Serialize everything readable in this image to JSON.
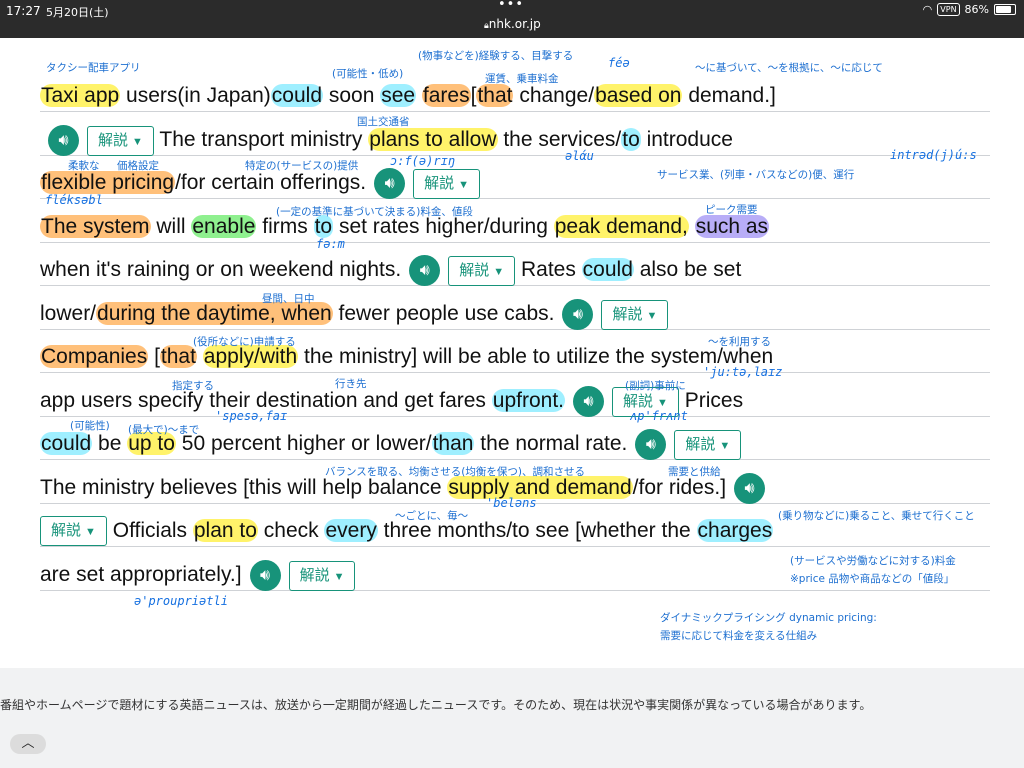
{
  "status_bar": {
    "time": "17:27",
    "date": "5月20日(土)",
    "url": "nhk.or.jp",
    "vpn": "VPN",
    "battery": "86%"
  },
  "article": {
    "lines": [
      {
        "segments": [
          {
            "t": "Taxi app",
            "hl": "y"
          },
          {
            "t": " users(in Japan)"
          },
          {
            "t": "could",
            "hl": "c"
          },
          {
            "t": " soon "
          },
          {
            "t": "see",
            "hl": "c"
          },
          {
            "t": " "
          },
          {
            "t": "fares",
            "hl": "o"
          },
          {
            "t": "["
          },
          {
            "t": "that",
            "hl": "o"
          },
          {
            "t": " change/"
          },
          {
            "t": "based on",
            "hl": "y"
          },
          {
            "t": " demand.]"
          }
        ]
      },
      {
        "segments": [
          {
            "speaker": true
          },
          {
            "expl": "解説"
          },
          {
            "t": "   The transport ministry "
          },
          {
            "t": "plans to allow",
            "hl": "y"
          },
          {
            "t": " the services/"
          },
          {
            "t": "to",
            "hl": "c"
          },
          {
            "t": " introduce"
          }
        ]
      },
      {
        "segments": [
          {
            "t": "flexible pricing",
            "hl": "o"
          },
          {
            "t": "/for certain offerings."
          },
          {
            "speaker": true
          },
          {
            "expl": "解説"
          }
        ]
      },
      {
        "segments": [
          {
            "t": "The system",
            "hl": "o"
          },
          {
            "t": " will "
          },
          {
            "t": "enable",
            "hl": "g"
          },
          {
            "t": " firms "
          },
          {
            "t": "to",
            "hl": "c"
          },
          {
            "t": " set rates higher/during "
          },
          {
            "t": "peak demand,",
            "hl": "y"
          },
          {
            "t": " "
          },
          {
            "t": "such as",
            "hl": "p"
          }
        ]
      },
      {
        "segments": [
          {
            "t": "when it's raining or on weekend nights."
          },
          {
            "speaker": true
          },
          {
            "expl": "解説"
          },
          {
            "t": "  Rates "
          },
          {
            "t": "could",
            "hl": "c"
          },
          {
            "t": " also be set"
          }
        ]
      },
      {
        "segments": [
          {
            "t": "lower/"
          },
          {
            "t": "during the daytime, when",
            "hl": "o"
          },
          {
            "t": " fewer people use cabs."
          },
          {
            "speaker": true
          },
          {
            "expl": "解説"
          }
        ]
      },
      {
        "segments": [
          {
            "t": "Companies",
            "hl": "o"
          },
          {
            "t": " ["
          },
          {
            "t": "that",
            "hl": "o"
          },
          {
            "t": " "
          },
          {
            "t": "apply/with",
            "hl": "y"
          },
          {
            "t": " the ministry] will be able to utilize the system/when"
          }
        ]
      },
      {
        "segments": [
          {
            "t": "app users specify their destination and get fares "
          },
          {
            "t": "upfront.",
            "hl": "c"
          },
          {
            "speaker": true
          },
          {
            "expl": "解説"
          },
          {
            "t": "   Prices"
          }
        ]
      },
      {
        "segments": [
          {
            "t": "could",
            "hl": "c"
          },
          {
            "t": " be "
          },
          {
            "t": "up to",
            "hl": "y"
          },
          {
            "t": " 50 percent higher or lower/"
          },
          {
            "t": "than",
            "hl": "c"
          },
          {
            "t": " the normal rate."
          },
          {
            "speaker": true
          },
          {
            "expl": "解説"
          }
        ]
      },
      {
        "segments": [
          {
            "t": "The ministry believes [this will help balance "
          },
          {
            "t": "supply and demand",
            "hl": "y"
          },
          {
            "t": "/for rides.]"
          },
          {
            "speaker": true
          }
        ]
      },
      {
        "segments": [
          {
            "expl": "解説"
          },
          {
            "t": "   Officials "
          },
          {
            "t": "plan to",
            "hl": "y"
          },
          {
            "t": " check "
          },
          {
            "t": "every",
            "hl": "c"
          },
          {
            "t": " three months/to see [whether the "
          },
          {
            "t": "charges",
            "hl": "c"
          }
        ]
      },
      {
        "segments": [
          {
            "t": "are set appropriately.]"
          },
          {
            "speaker": true
          },
          {
            "expl": "解説"
          }
        ]
      }
    ]
  },
  "annotations": [
    {
      "text": "タクシー配車アプリ"
    },
    {
      "text": "(物事などを)経験する、目撃する"
    },
    {
      "text": "(可能性・低め)"
    },
    {
      "text": "運賃、乗車料金"
    },
    {
      "text": "～に基づいて、～を根拠に、～に応じて"
    },
    {
      "text": "国土交通省"
    },
    {
      "text": "柔軟な"
    },
    {
      "text": "価格設定"
    },
    {
      "text": "特定の(サービスの)提供"
    },
    {
      "text": "サービス業、(列車・バスなどの)便、運行"
    },
    {
      "text": "(一定の基準に基づいて決まる)料金、値段"
    },
    {
      "text": "ピーク需要"
    },
    {
      "text": "昼間、日中"
    },
    {
      "text": "(役所などに)申請する"
    },
    {
      "text": "～を利用する"
    },
    {
      "text": "指定する"
    },
    {
      "text": "行き先"
    },
    {
      "text": "(副詞)事前に"
    },
    {
      "text": "(可能性)"
    },
    {
      "text": "(最大で)～まで"
    },
    {
      "text": "バランスを取る、均衡させる(均衡を保つ)、調和させる"
    },
    {
      "text": "需要と供給"
    },
    {
      "text": "～ごとに、毎～"
    },
    {
      "text": "(乗り物などに)乗ること、乗せて行くこと"
    },
    {
      "text": "(サービスや労働などに対する)料金"
    },
    {
      "text": "※price 品物や商品などの「値段」"
    },
    {
      "text": "ダイナミックプライシング dynamic pricing:"
    },
    {
      "text": "需要に応じて料金を変える仕組み"
    }
  ],
  "pronunciations": [
    {
      "text": "féə"
    },
    {
      "text": "əlάu"
    },
    {
      "text": "ɔ:f(ə)rɪŋ"
    },
    {
      "text": "intrəd(j)ú:s"
    },
    {
      "text": "fléksəbl"
    },
    {
      "text": "fə:m"
    },
    {
      "text": "'ju:tə,laɪz"
    },
    {
      "text": "'spesə,faɪ"
    },
    {
      "text": "ʌp'frʌnt"
    },
    {
      "text": "'beləns"
    },
    {
      "text": "ə'proupriətli"
    }
  ],
  "footer": {
    "notice": "番組やホームページで題材にする英語ニュースは、放送から一定期間が経過したニュースです。そのため、現在は状況や事実関係が異なっている場合があります。",
    "collapse_label": "︿"
  },
  "icons": {
    "speaker": "speaker-icon",
    "caret": "caret-down-icon",
    "lock": "lock-icon",
    "wifi": "wifi-icon",
    "battery": "battery-icon"
  },
  "colors": {
    "accent": "#17937a",
    "highlight_yellow": "#fff36a",
    "highlight_orange": "#ffc07a",
    "highlight_cyan": "#9fefff",
    "highlight_green": "#8ff08f",
    "highlight_purple": "#b8adf7",
    "annotation": "#1d6fd0"
  }
}
